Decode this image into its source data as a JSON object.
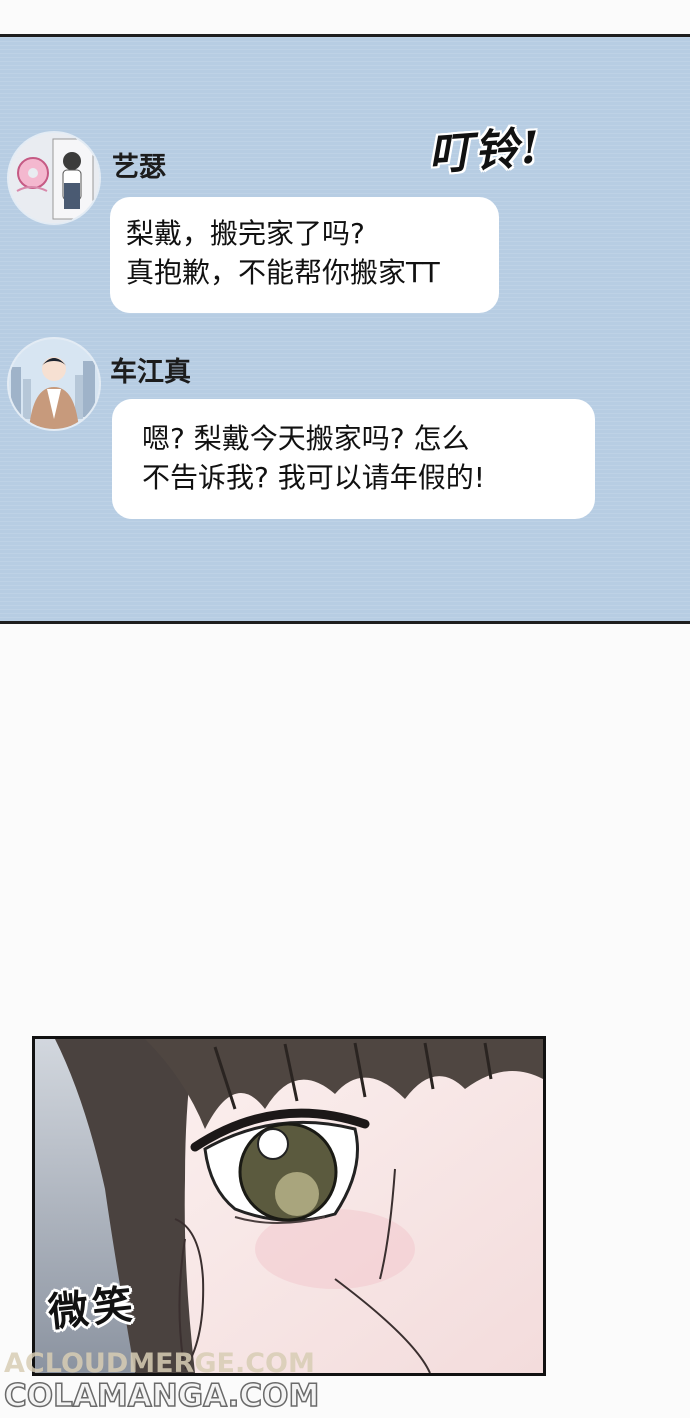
{
  "sound_effects": {
    "ding": "叮铃!",
    "smile": "微笑"
  },
  "chat": {
    "messages": [
      {
        "sender": "艺瑟",
        "avatar_icon": "girl-with-donut-avatar",
        "lines": [
          "梨戴，搬完家了吗?",
          "真抱歉，不能帮你搬家TT"
        ]
      },
      {
        "sender": "车江真",
        "avatar_icon": "man-in-city-avatar",
        "lines": [
          "嗯? 梨戴今天搬家吗? 怎么",
          "不告诉我? 我可以请年假的!"
        ]
      }
    ],
    "background_color": "#b7cde3",
    "bubble_color": "#ffffff"
  },
  "watermarks": {
    "top": "ACLOUDMERGE.COM",
    "bottom": "COLAMANGA.COM"
  }
}
